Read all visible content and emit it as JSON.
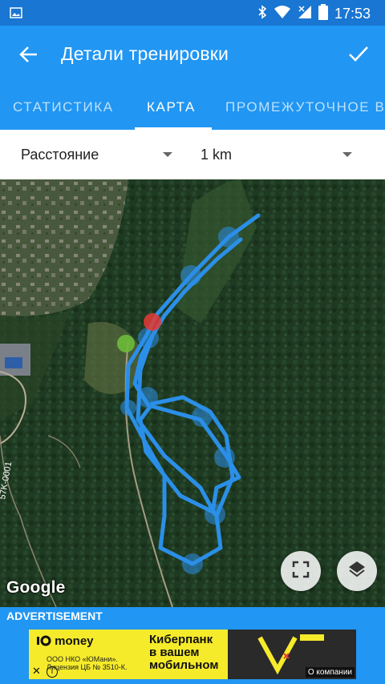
{
  "status_bar": {
    "time": "17:53",
    "icons": [
      "image-icon",
      "bluetooth-icon",
      "wifi-icon",
      "signal-icon",
      "battery-icon"
    ]
  },
  "app_bar": {
    "title": "Детали тренировки",
    "back_icon": "arrow-back-icon",
    "confirm_icon": "check-icon"
  },
  "tabs": [
    {
      "label": "СТАТИСТИКА",
      "active": false
    },
    {
      "label": "КАРТА",
      "active": true
    },
    {
      "label": "ПРОМЕЖУТОЧНОЕ В",
      "active": false
    }
  ],
  "selectors": {
    "metric": "Расстояние",
    "interval": "1 km"
  },
  "map": {
    "attribution": "Google",
    "road_label": "57K-0001",
    "route_color": "#2b8fe8",
    "start_color": "#6dbb3b",
    "finish_color": "#e53935",
    "buttons": [
      "fullscreen-icon",
      "layers-icon"
    ]
  },
  "ad": {
    "label": "ADVERTISEMENT",
    "brand": "money",
    "license_text": "ООО НКО «ЮМани». Лицензия ЦБ № 3510-К.",
    "headline_1": "Киберпанк",
    "headline_2": "в вашем",
    "headline_3": "мобильном",
    "company_link": "О компании",
    "accent_color": "#f5eb2a"
  }
}
